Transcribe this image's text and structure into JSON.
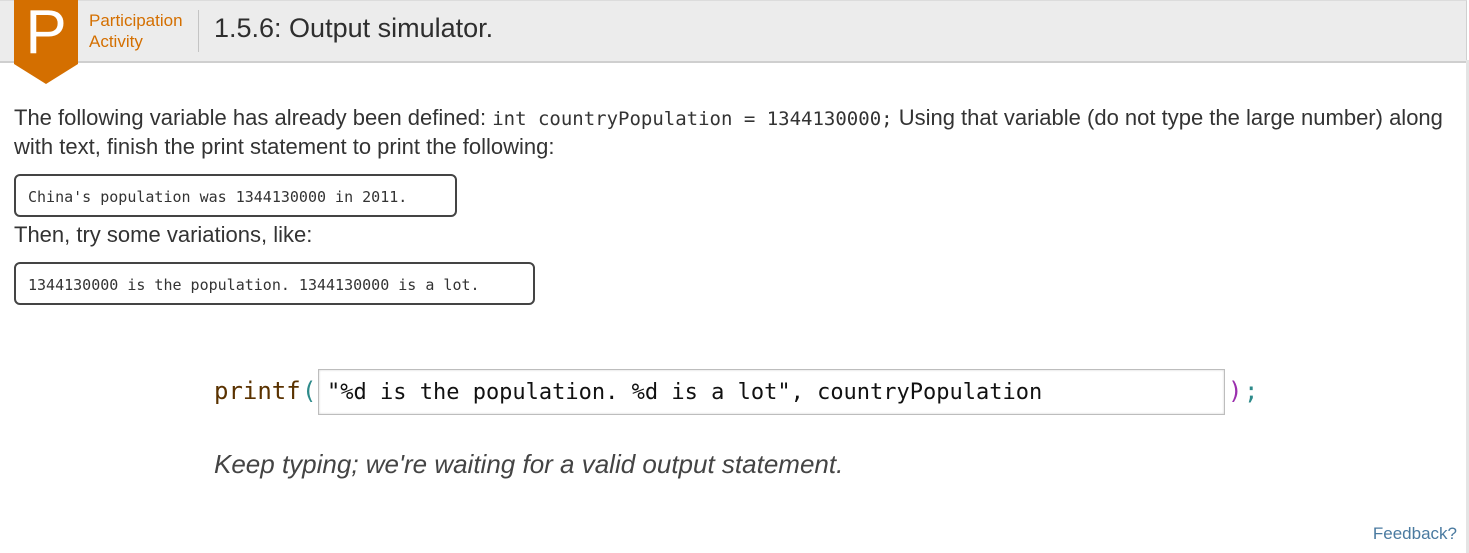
{
  "header": {
    "badge_letter": "P",
    "activity_label_line1": "Participation",
    "activity_label_line2": "Activity",
    "title": "1.5.6: Output simulator."
  },
  "instructions": {
    "text_before_code": "The following variable has already been defined: ",
    "code_declaration": "int countryPopulation  = 1344130000;",
    "text_after_code": " Using that variable (do not type the large number) along with text, finish the print statement to print the following:"
  },
  "example_output_1": "China's population was 1344130000 in 2011.",
  "then_text": "Then, try some variations, like:",
  "example_output_2": "1344130000 is the population. 1344130000 is a lot.",
  "code": {
    "prefix": "printf",
    "open_paren": "(",
    "input_value": "\"%d is the population. %d is a lot\", countryPopulation",
    "close_paren": ")",
    "semicolon": ";"
  },
  "status_message": "Keep typing; we're waiting for a valid output statement.",
  "feedback_link": "Feedback?",
  "colors": {
    "brand_orange": "#d46f00",
    "printf_color": "#5a3200",
    "paren_open_color": "#2d8a8a",
    "paren_close_color": "#9b2fae",
    "link_color": "#4a7aa0"
  },
  "icons": {
    "badge": "participation-activity-badge-icon"
  }
}
